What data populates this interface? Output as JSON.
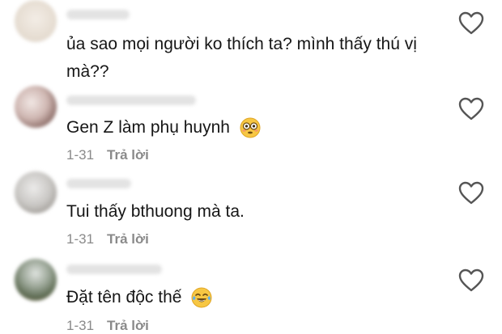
{
  "comments": [
    {
      "text": "ủa sao mọi người ko thích ta? mình thấy thú vị mà??",
      "date": "",
      "reply": "",
      "emoji": ""
    },
    {
      "text": "Gen Z làm phụ huynh",
      "date": "1-31",
      "reply": "Trả lời",
      "emoji": "flushed-face"
    },
    {
      "text": "Tui thấy bthuong mà ta.",
      "date": "1-31",
      "reply": "Trả lời",
      "emoji": ""
    },
    {
      "text": "Đặt tên độc thế",
      "date": "1-31",
      "reply": "Trả lời",
      "emoji": "tears-of-joy-face"
    }
  ],
  "colors": {
    "text": "#161616",
    "meta": "#8a8a8a",
    "heart": "#555555"
  }
}
